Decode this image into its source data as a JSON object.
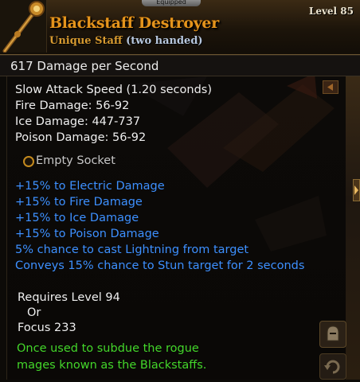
{
  "header": {
    "equipped_label": "Equipped",
    "item_name": "Blackstaff Destroyer",
    "item_quality": "Unique Staff",
    "item_hands": "(two handed)",
    "level_label": "Level 85",
    "icon": "staff-icon"
  },
  "dps": "617  Damage per Second",
  "base_stats": [
    "Slow Attack Speed (1.20 seconds)",
    "Fire Damage: 56-92",
    "Ice Damage: 447-737",
    "Poison Damage: 56-92"
  ],
  "socket": {
    "label": "Empty Socket",
    "icon": "socket-ring-icon"
  },
  "magic_stats": [
    "+15% to Electric Damage",
    "+15% to Fire Damage",
    "+15% to Ice Damage",
    "+15% to Poison Damage",
    "5% chance to cast Lightning from target",
    "Conveys 15% chance to Stun target for 2 seconds"
  ],
  "requirements": {
    "level": "Requires Level 94",
    "or": "Or",
    "focus": "Focus 233"
  },
  "flavor": [
    "Once used to subdue the rogue",
    "mages known as the Blackstaffs."
  ],
  "colors": {
    "item_name": "#e4941c",
    "magic_stat": "#3d90ff",
    "flavor": "#43d62a",
    "base_stat": "#eeeeee"
  }
}
